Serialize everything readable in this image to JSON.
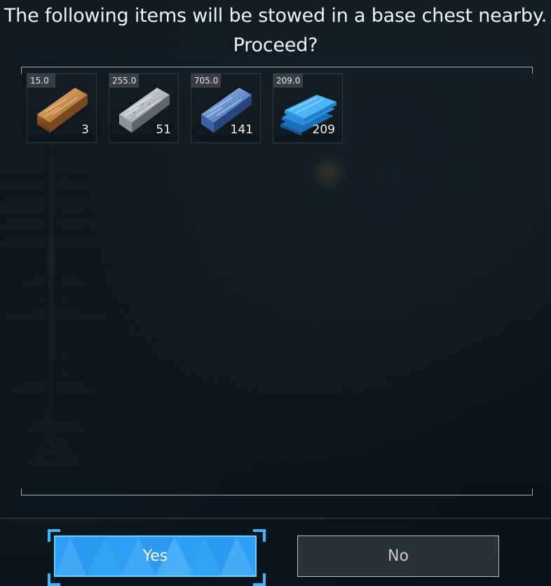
{
  "dialog": {
    "title_line1": "The following items will be stowed in a base chest nearby.",
    "title_line2": "Proceed?"
  },
  "items": [
    {
      "weight": "15.0",
      "quantity": "3",
      "icon": "copper-ingot-icon",
      "color": "#b87333"
    },
    {
      "weight": "255.0",
      "quantity": "51",
      "icon": "refined-ingot-icon",
      "color": "#a9b0b8"
    },
    {
      "weight": "705.0",
      "quantity": "141",
      "icon": "polymer-ingot-icon",
      "color": "#4a7fd0"
    },
    {
      "weight": "209.0",
      "quantity": "209",
      "icon": "plasteel-plates-icon",
      "color": "#3aa8ef"
    }
  ],
  "buttons": {
    "yes_label": "Yes",
    "no_label": "No"
  },
  "colors": {
    "accent": "#2f9ff5",
    "frame": "#8fb3c8"
  }
}
